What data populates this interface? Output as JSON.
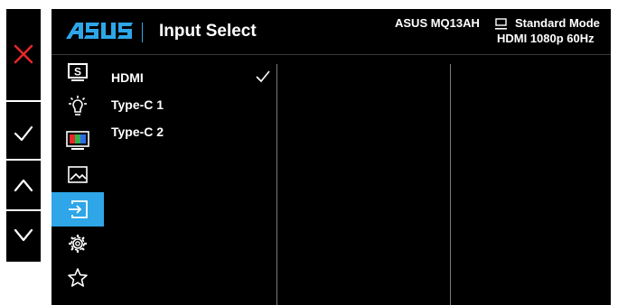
{
  "header": {
    "brand": "ASUS",
    "title": "Input Select",
    "model": "ASUS MQ13AH",
    "mode": "Standard Mode",
    "signal": "HDMI  1080p 60Hz"
  },
  "keys": [
    {
      "name": "close",
      "icon": "close-icon",
      "color": "#e8262b"
    },
    {
      "name": "confirm",
      "icon": "check-icon"
    },
    {
      "name": "up",
      "icon": "chevron-up-icon"
    },
    {
      "name": "down",
      "icon": "chevron-down-icon"
    }
  ],
  "sidebar": {
    "items": [
      {
        "icon": "splendid-icon",
        "active": false
      },
      {
        "icon": "blue-light-filter-icon",
        "active": false
      },
      {
        "icon": "color-icon",
        "active": false
      },
      {
        "icon": "image-icon",
        "active": false
      },
      {
        "icon": "input-select-icon",
        "active": true
      },
      {
        "icon": "system-setup-icon",
        "active": false
      },
      {
        "icon": "shortcut-icon",
        "active": false
      }
    ]
  },
  "options": [
    {
      "label": "HDMI",
      "selected": true
    },
    {
      "label": "Type-C 1",
      "selected": false
    },
    {
      "label": "Type-C 2",
      "selected": false
    }
  ],
  "colors": {
    "accent": "#2ea6e8",
    "background": "#000000",
    "close_red": "#e8262b"
  }
}
